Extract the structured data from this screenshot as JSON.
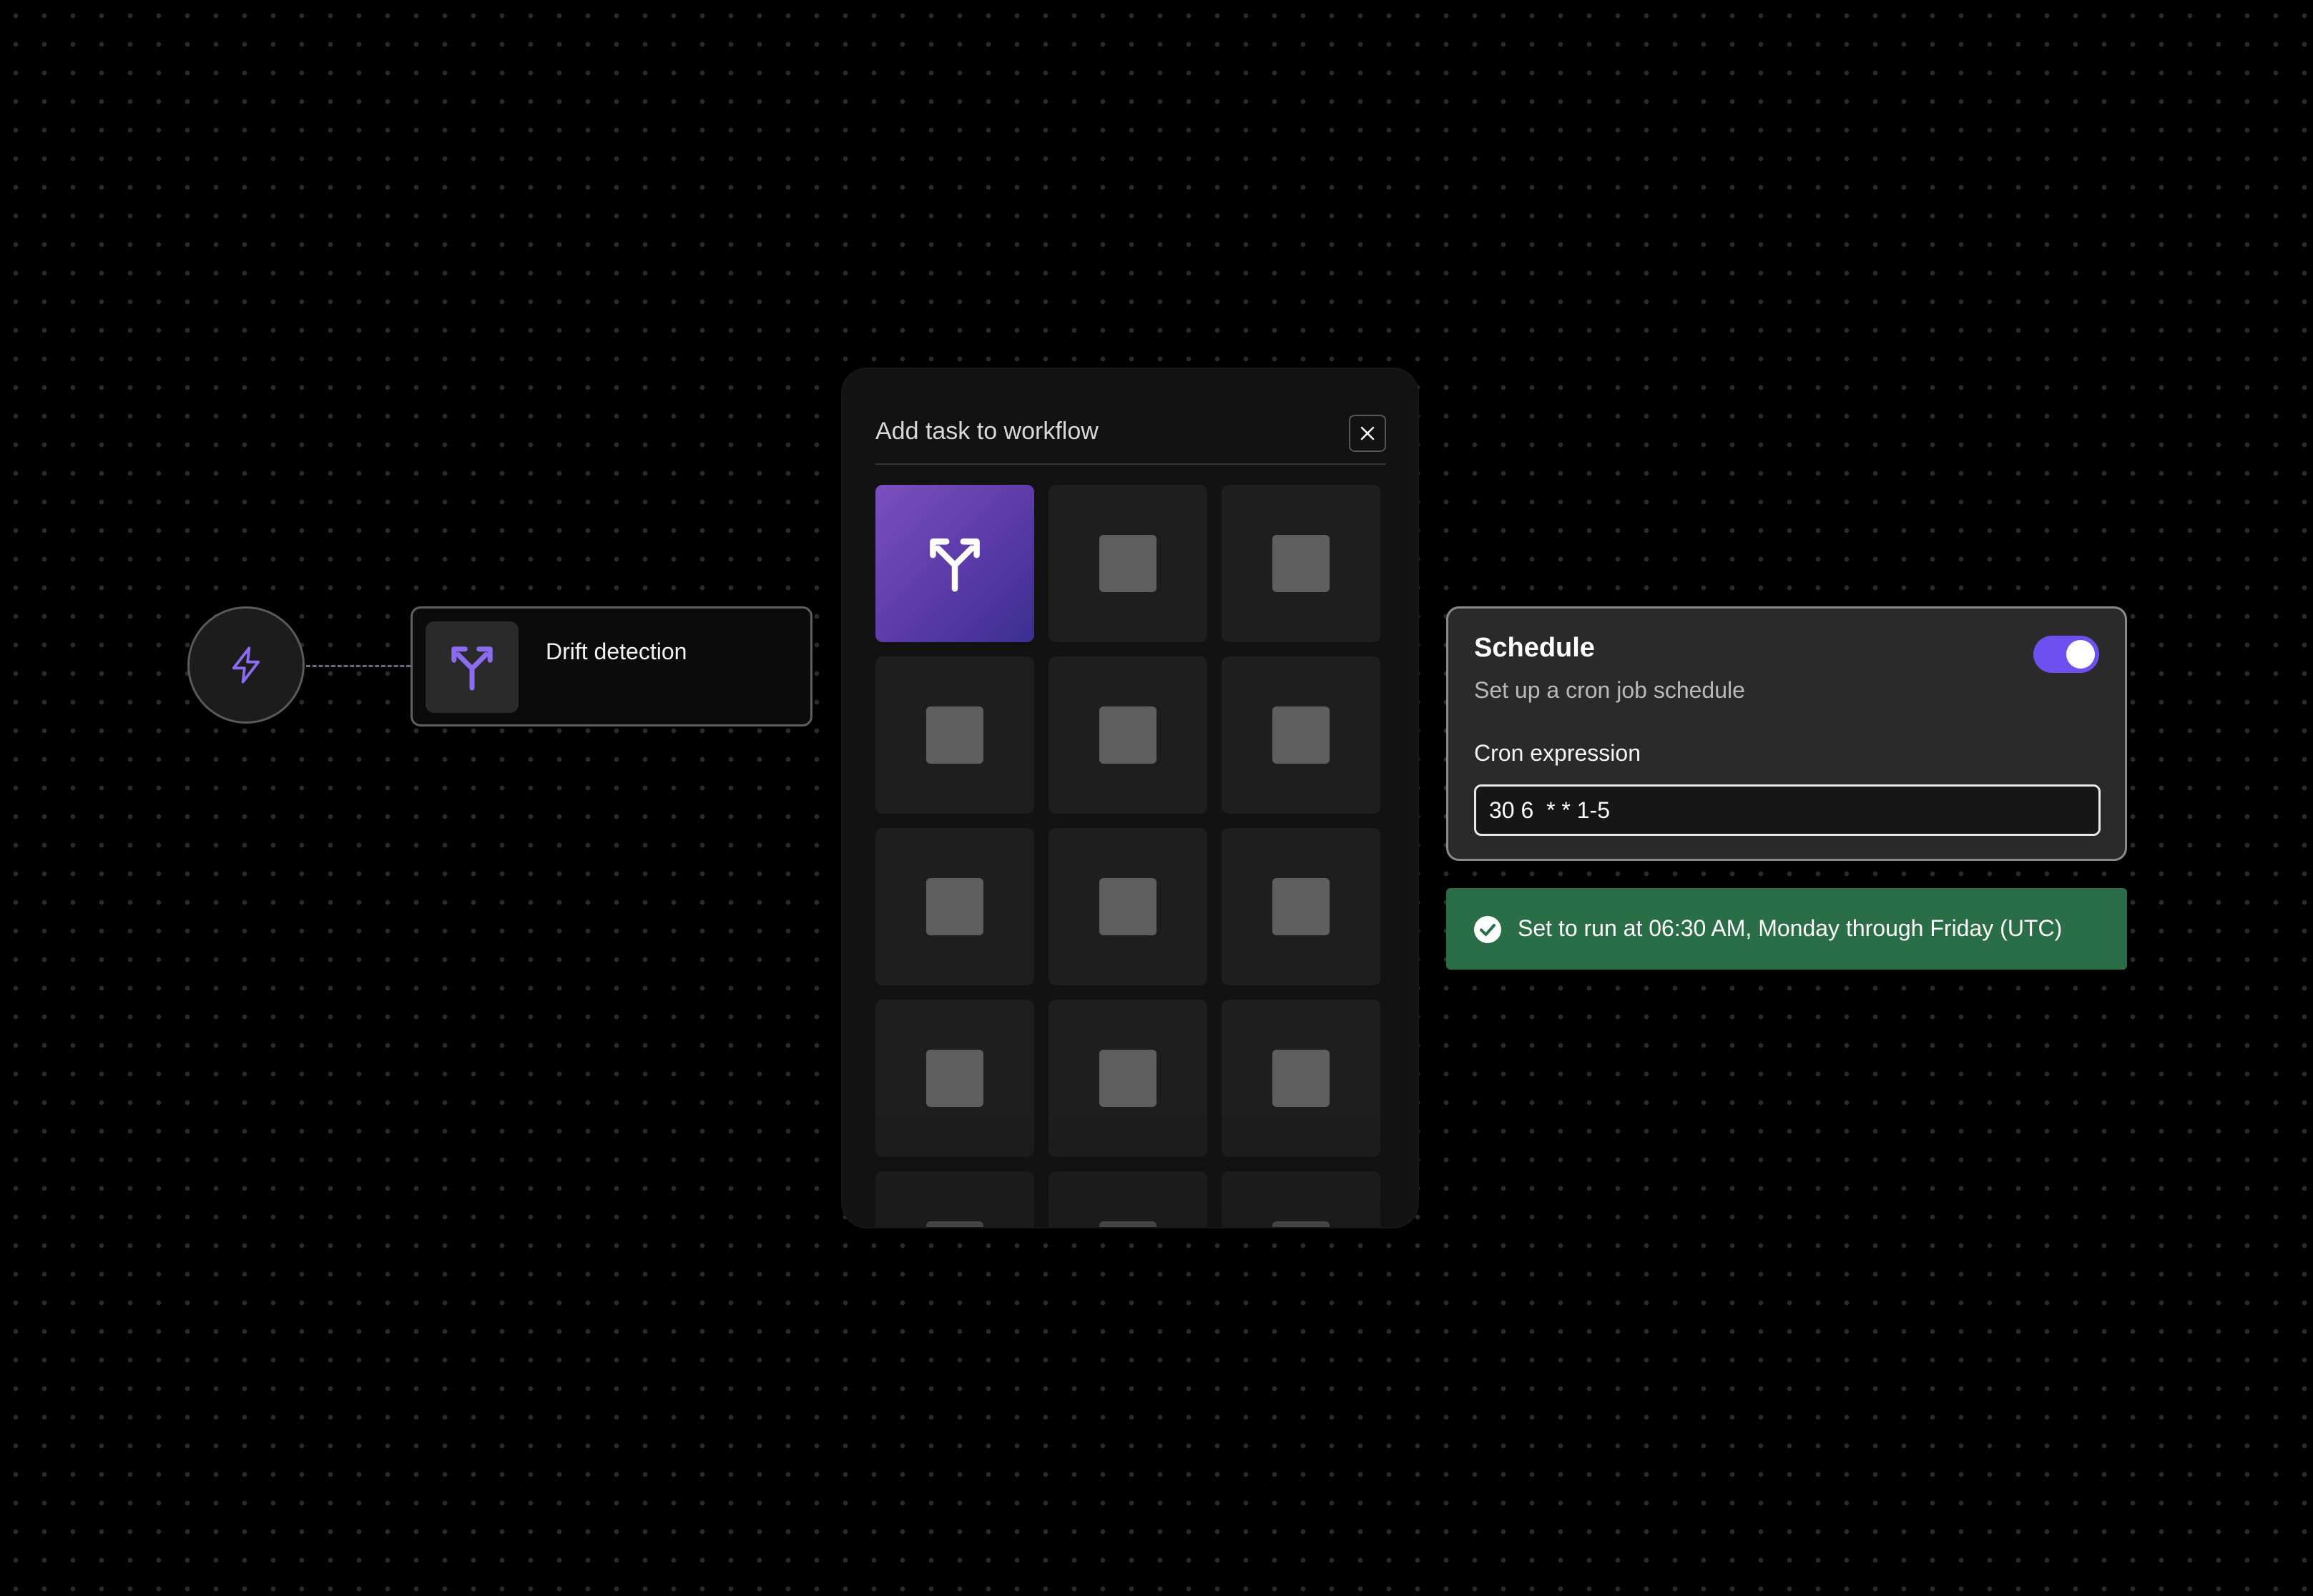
{
  "workflow": {
    "trigger_icon": "lightning-icon",
    "task_node": {
      "label": "Drift detection",
      "icon": "fork-arrows-icon",
      "accent": "#8b6cf0"
    }
  },
  "modal": {
    "title": "Add task to workflow",
    "close_icon": "close-icon",
    "selected_tile_icon": "fork-arrows-icon"
  },
  "schedule": {
    "title": "Schedule",
    "subtitle": "Set up a cron job schedule",
    "enabled": true,
    "cron_label": "Cron expression",
    "cron_value": "30 6  * * 1-5",
    "toggle_color": "#6e4ff0"
  },
  "status": {
    "message": "Set to run at 06:30 AM, Monday through Friday (UTC)",
    "icon": "check-circle-icon",
    "color": "#2a6e47"
  }
}
